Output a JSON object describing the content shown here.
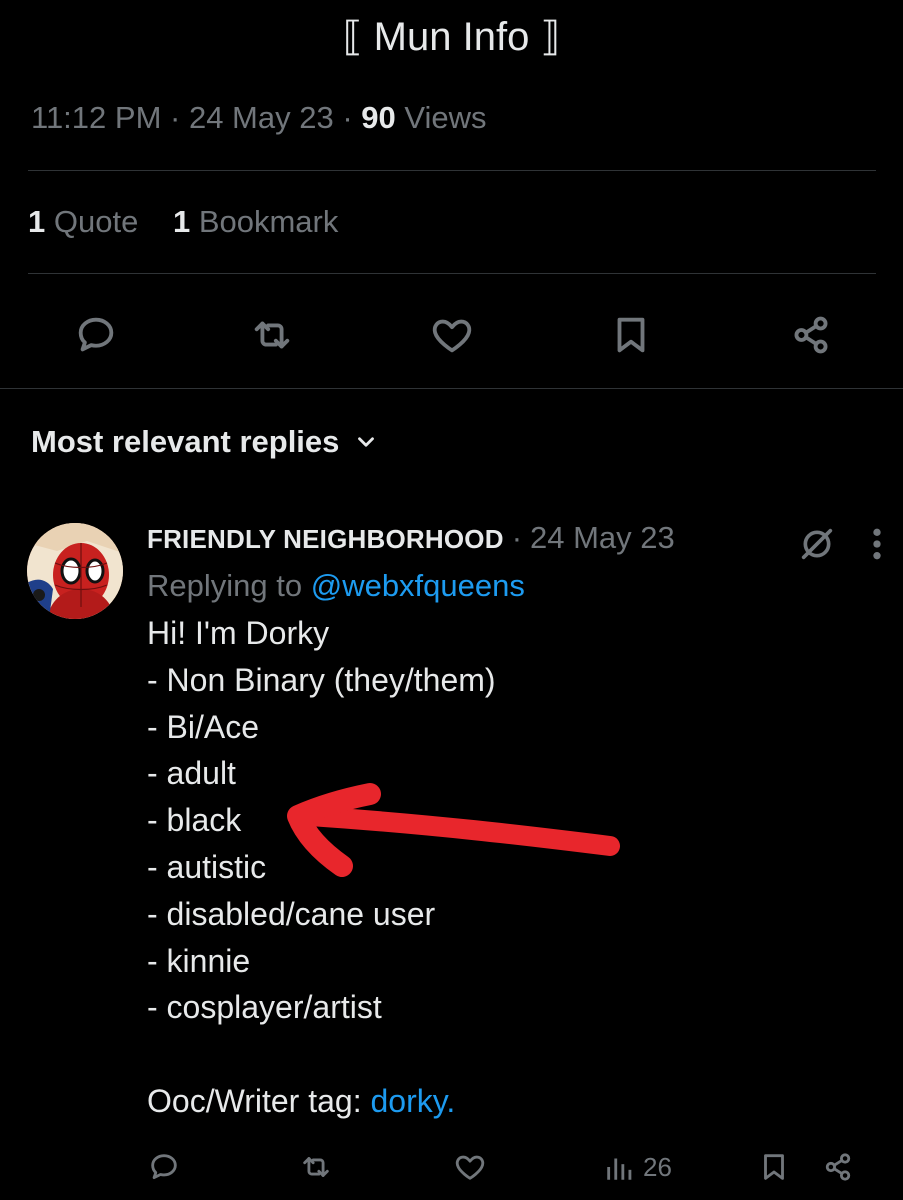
{
  "tweet": {
    "title": "⟦ Mun Info ⟧",
    "time": "11:12 PM",
    "date": "24 May 23",
    "views_count": "90",
    "views_label": "Views",
    "quotes_count": "1",
    "quotes_label": "Quote",
    "bookmarks_count": "1",
    "bookmarks_label": "Bookmark"
  },
  "replies_header": {
    "label": "Most relevant replies"
  },
  "reply": {
    "name": "FRIENDLY NEIGHBORHOOD",
    "date": "24 May 23",
    "replying_prefix": "Replying to",
    "replying_handle": "@webxfqueens",
    "lines": [
      "Hi! I'm Dorky",
      "- Non Binary (they/them)",
      "- Bi/Ace",
      "- adult",
      "- black",
      "- autistic",
      "- disabled/cane user",
      "- kinnie",
      "- cosplayer/artist"
    ],
    "tag_prefix": "Ooc/Writer tag:",
    "tag_link": "dorky.",
    "views_count": "26"
  },
  "colors": {
    "background": "#000000",
    "text": "#e7e9ea",
    "muted": "#71767b",
    "link": "#1d9bf0",
    "annotation_arrow": "#e8262c"
  },
  "icons": {
    "reply": "speech-bubble",
    "retweet": "retweet-arrows",
    "like": "heart-outline",
    "bookmark": "bookmark-outline",
    "share": "share-nodes",
    "grok": "slashed-circle",
    "more": "vertical-dots",
    "views": "bar-chart",
    "sort": "chevron-down"
  }
}
